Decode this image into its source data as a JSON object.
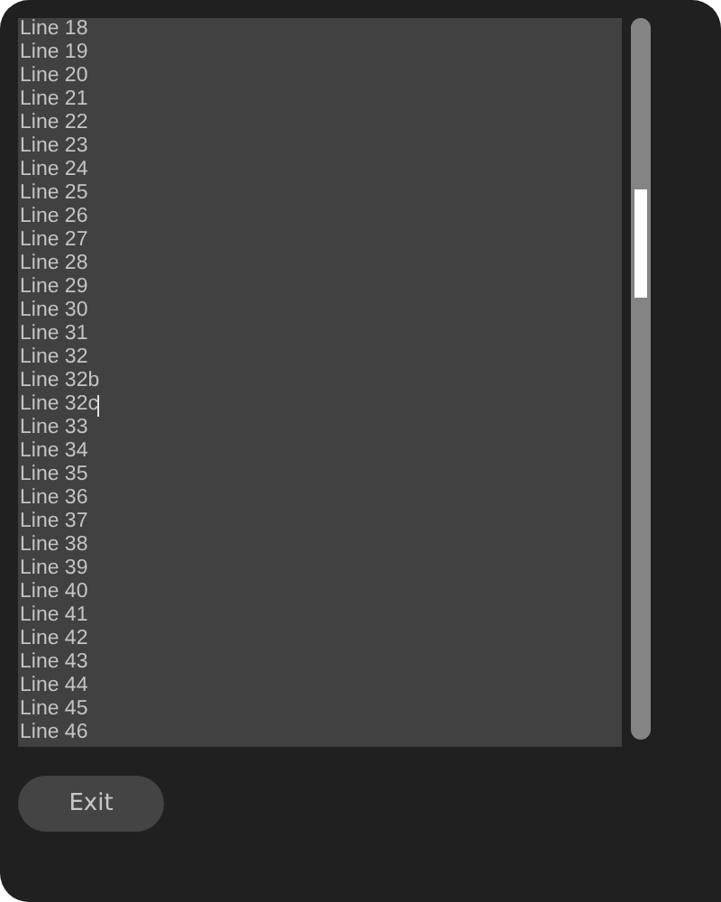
{
  "editor": {
    "lines": [
      {
        "text": "Line 18",
        "caret": false
      },
      {
        "text": "Line 19",
        "caret": false
      },
      {
        "text": "Line 20",
        "caret": false
      },
      {
        "text": "Line 21",
        "caret": false
      },
      {
        "text": "Line 22",
        "caret": false
      },
      {
        "text": "Line 23",
        "caret": false
      },
      {
        "text": "Line 24",
        "caret": false
      },
      {
        "text": "Line 25",
        "caret": false
      },
      {
        "text": "Line 26",
        "caret": false
      },
      {
        "text": "Line 27",
        "caret": false
      },
      {
        "text": "Line 28",
        "caret": false
      },
      {
        "text": "Line 29",
        "caret": false
      },
      {
        "text": "Line 30",
        "caret": false
      },
      {
        "text": "Line 31",
        "caret": false
      },
      {
        "text": "Line 32",
        "caret": false
      },
      {
        "text": "Line 32b",
        "caret": false
      },
      {
        "text": "Line 32c",
        "caret": true
      },
      {
        "text": "Line 33",
        "caret": false
      },
      {
        "text": "Line 34",
        "caret": false
      },
      {
        "text": "Line 35",
        "caret": false
      },
      {
        "text": "Line 36",
        "caret": false
      },
      {
        "text": "Line 37",
        "caret": false
      },
      {
        "text": "Line 38",
        "caret": false
      },
      {
        "text": "Line 39",
        "caret": false
      },
      {
        "text": "Line 40",
        "caret": false
      },
      {
        "text": "Line 41",
        "caret": false
      },
      {
        "text": "Line 42",
        "caret": false
      },
      {
        "text": "Line 43",
        "caret": false
      },
      {
        "text": "Line 44",
        "caret": false
      },
      {
        "text": "Line 45",
        "caret": false
      },
      {
        "text": "Line 46",
        "caret": false
      }
    ]
  },
  "buttons": [
    {
      "label": "Exit"
    }
  ]
}
